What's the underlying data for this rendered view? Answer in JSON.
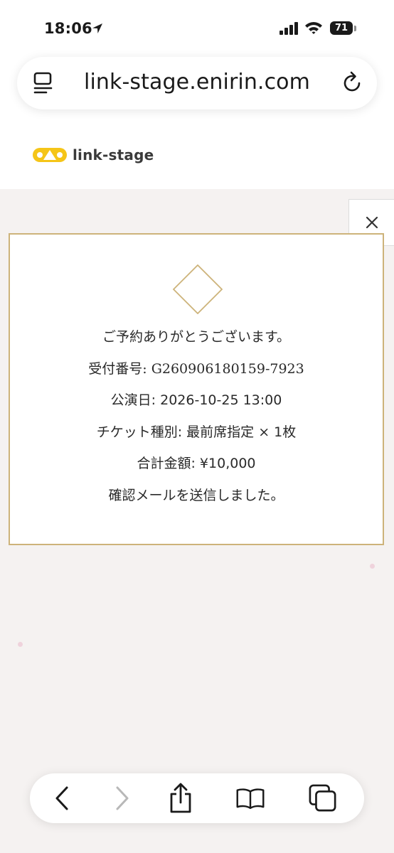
{
  "status_bar": {
    "time": "18:06",
    "battery": "71"
  },
  "browser": {
    "url": "link-stage.enirin.com"
  },
  "site": {
    "logo_text": "link-stage",
    "brand_color": "#f5c518"
  },
  "confirmation": {
    "thanks": "ご予約ありがとうございます。",
    "reservation_number": "受付番号: G260906180159-7923",
    "performance_date": "公演日: 2026-10-25 13:00",
    "ticket_type": "チケット種別: 最前席指定 × 1枚",
    "total_amount": "合計金額: ¥10,000",
    "email_sent": "確認メールを送信しました。"
  },
  "colors": {
    "card_border": "#cdb37a",
    "page_background": "#f5f2f1"
  },
  "toolbar": {
    "icons": [
      "back-icon",
      "forward-icon",
      "share-icon",
      "bookmarks-icon",
      "tabs-icon"
    ]
  }
}
